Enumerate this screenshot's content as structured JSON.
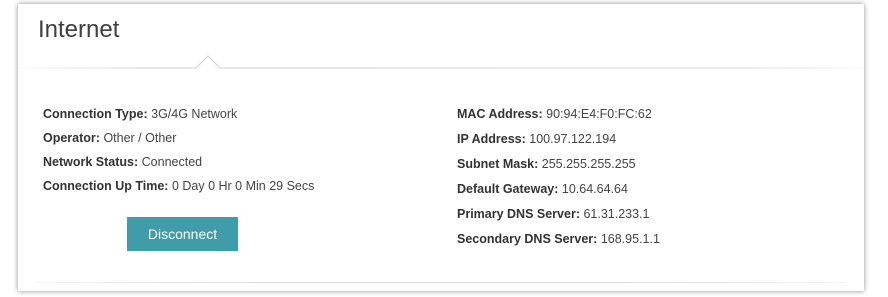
{
  "panel": {
    "title": "Internet"
  },
  "left": {
    "items": [
      {
        "label": "Connection Type:",
        "value": "3G/4G Network"
      },
      {
        "label": "Operator:",
        "value": "Other / Other"
      },
      {
        "label": "Network Status:",
        "value": "Connected"
      },
      {
        "label": "Connection Up Time:",
        "value": "0 Day 0 Hr 0 Min 29 Secs"
      }
    ],
    "disconnect_label": "Disconnect"
  },
  "right": {
    "items": [
      {
        "label": "MAC Address:",
        "value": "90:94:E4:F0:FC:62"
      },
      {
        "label": "IP Address:",
        "value": "100.97.122.194"
      },
      {
        "label": "Subnet Mask:",
        "value": "255.255.255.255"
      },
      {
        "label": "Default Gateway:",
        "value": "10.64.64.64"
      },
      {
        "label": "Primary DNS Server:",
        "value": "61.31.233.1"
      },
      {
        "label": "Secondary DNS Server:",
        "value": "168.95.1.1"
      }
    ]
  },
  "colors": {
    "button": "#3f9ca8",
    "title": "#404040",
    "text": "#333333"
  }
}
